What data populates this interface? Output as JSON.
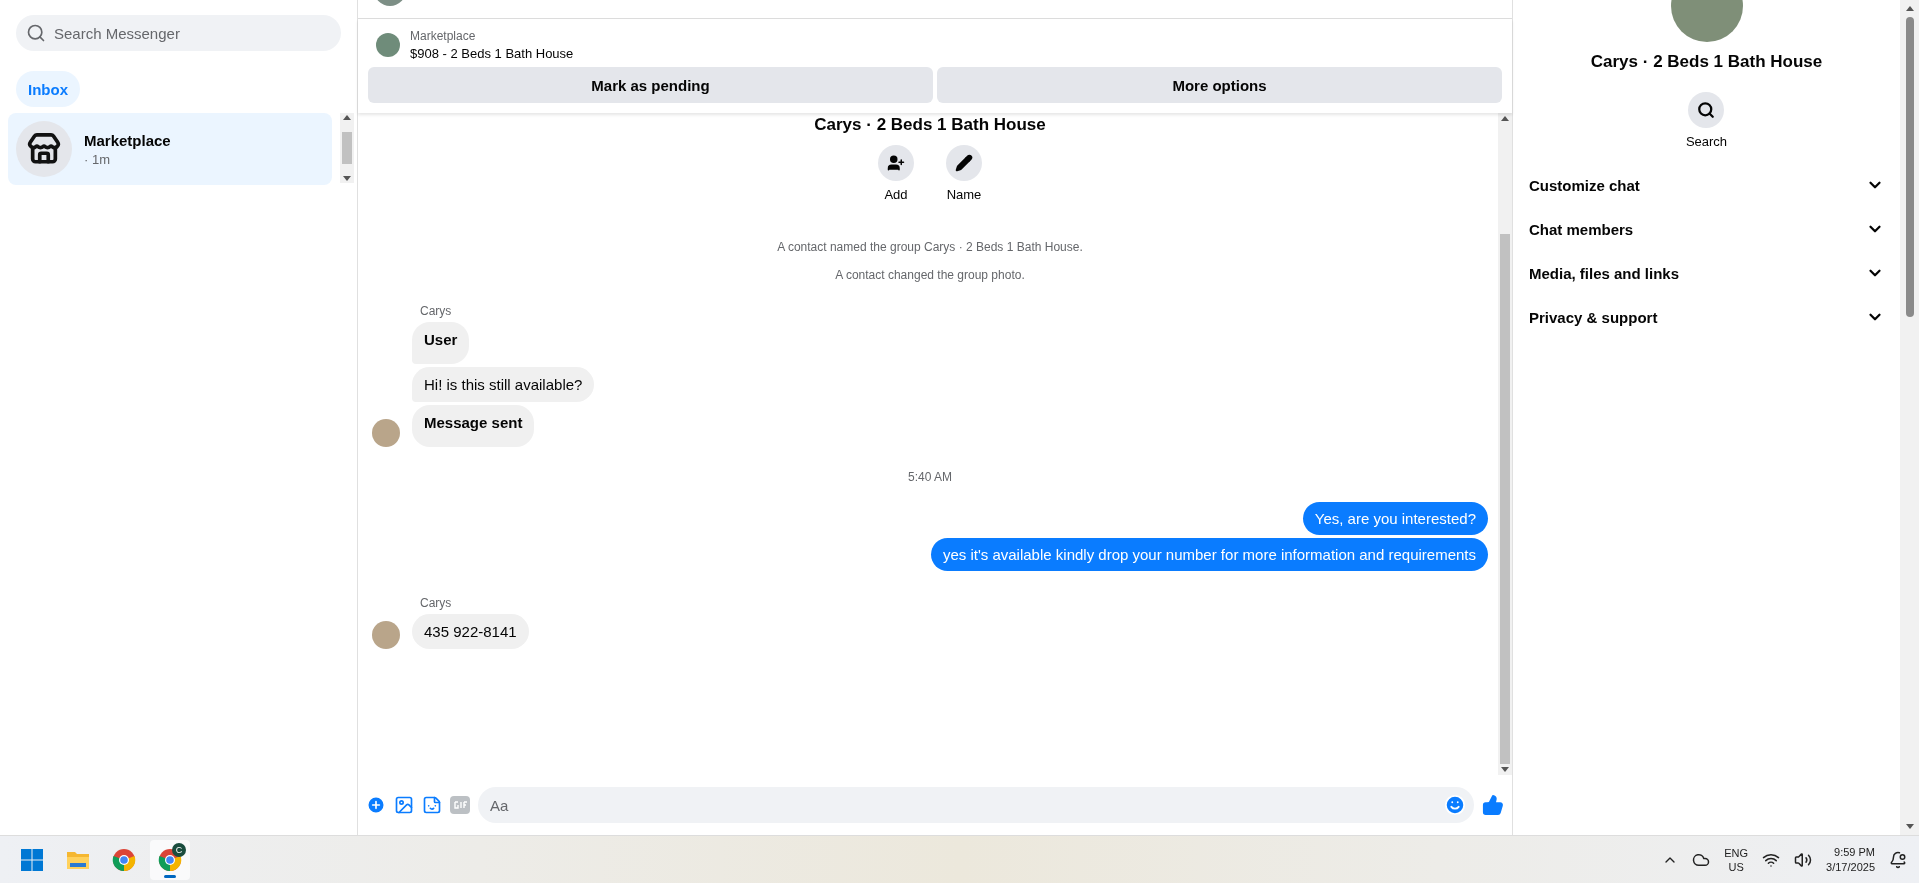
{
  "sidebar": {
    "search": {
      "placeholder": "Search Messenger"
    },
    "tabs": [
      {
        "label": "Inbox",
        "selected": true
      }
    ],
    "conversations": [
      {
        "name": "Marketplace",
        "meta": "· 1m",
        "selected": true
      }
    ]
  },
  "listing": {
    "source": "Marketplace",
    "title": "$908 - 2 Beds 1 Bath House",
    "buttons": [
      "Mark as pending",
      "More options"
    ]
  },
  "chat": {
    "group_title": "Carys · 2 Beds 1 Bath House",
    "actions": [
      {
        "kind": "add",
        "label": "Add"
      },
      {
        "kind": "name",
        "label": "Name"
      }
    ],
    "messages": [
      {
        "kind": "notice",
        "text": "A contact named the group Carys · 2 Beds 1 Bath House."
      },
      {
        "kind": "notice",
        "text": "A contact changed the group photo."
      },
      {
        "kind": "sender",
        "text": "Carys"
      },
      {
        "kind": "incoming",
        "text": "User",
        "bold": true,
        "avatar": false
      },
      {
        "kind": "incoming",
        "text": "Hi! is this still available?",
        "bold": false,
        "avatar": false
      },
      {
        "kind": "incoming",
        "text": "Message sent",
        "bold": true,
        "avatar": true
      },
      {
        "kind": "time",
        "text": "5:40 AM"
      },
      {
        "kind": "outgoing",
        "text": "Yes, are you interested?"
      },
      {
        "kind": "outgoing",
        "text": "yes it's available kindly drop your number for more information and requirements"
      },
      {
        "kind": "sender",
        "text": "Carys"
      },
      {
        "kind": "incoming",
        "text": "435 922-8141",
        "bold": false,
        "avatar": true
      }
    ]
  },
  "composer": {
    "placeholder": "Aa"
  },
  "details": {
    "title": "Carys · 2 Beds 1 Bath House",
    "actions": [
      {
        "label": "Search"
      }
    ],
    "sections": [
      {
        "label": "Customize chat",
        "expanded": false
      },
      {
        "label": "Chat members",
        "expanded": false
      },
      {
        "label": "Media, files and links",
        "expanded": false
      },
      {
        "label": "Privacy & support",
        "expanded": false
      }
    ]
  },
  "taskbar": {
    "apps": [
      {
        "kind": "start",
        "selected": false
      },
      {
        "kind": "files",
        "selected": false
      },
      {
        "kind": "browser",
        "selected": false
      },
      {
        "kind": "profile-browser",
        "badge": "C",
        "selected": true
      }
    ],
    "language": "ENG",
    "region": "US",
    "time": "9:59 PM",
    "date": "3/17/2025"
  }
}
